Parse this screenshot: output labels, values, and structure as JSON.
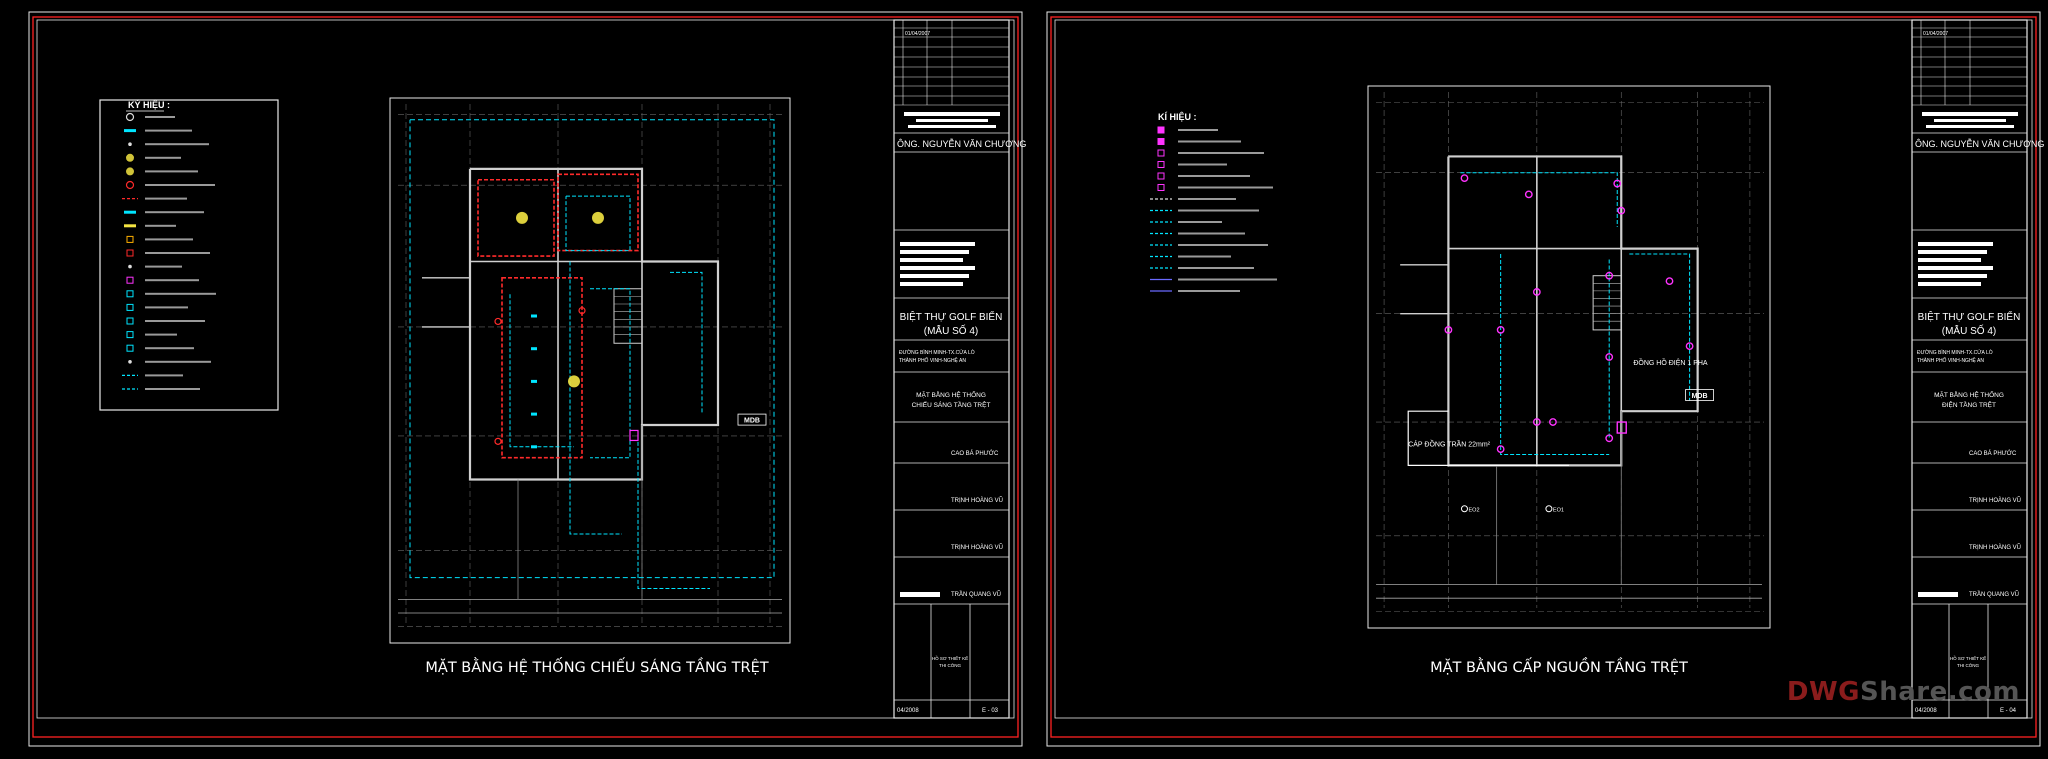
{
  "watermark": {
    "left": "DWG",
    "right": "Share.com"
  },
  "colors": {
    "frame_red": "#ff2222",
    "frame_white": "#e8e8e8",
    "wire_cyan": "#00e5ff",
    "wall_white": "#d0d0d0",
    "grid": "#3a3a3a",
    "magenta": "#ff33ff",
    "red_room": "#ff2a2a",
    "yellow": "#f4e542"
  },
  "sheets": [
    {
      "title": "MẶT BẰNG HỆ THỐNG CHIẾU SÁNG TẦNG TRỆT",
      "legend": {
        "heading": "KÝ HIỆU :",
        "kind": "lighting"
      },
      "mdb_label": "MDB",
      "block": {
        "date": "01/04/2007",
        "owner": "ÔNG. NGUYỄN VĂN CHƯƠNG",
        "project_name": "BIỆT THỰ GOLF BIỂN",
        "project_model": "(MẪU SỐ 4)",
        "location_1": "ĐƯỜNG BÌNH MINH-TX.CỬA LÒ",
        "location_2": "THÀNH PHỐ VINH-NGHỆ AN",
        "drawing_1": "MẶT BẰNG HỆ THỐNG",
        "drawing_2": "CHIẾU SÁNG TẦNG TRỆT",
        "chief": "CAO BÁ PHƯỚC",
        "designer": "TRỊNH HOÀNG VŨ",
        "cad": "TRỊNH HOÀNG VŨ",
        "manager": "TRẦN QUANG VŨ",
        "stage_1": "HỒ SƠ THIẾT KẾ",
        "stage_2": "THI CÔNG",
        "issue_date": "04/2008",
        "sheet_no": "E - 03"
      }
    },
    {
      "title": "MẶT BẰNG CẤP NGUỒN TẦNG TRỆT",
      "legend": {
        "heading": "KÍ HIỆU :",
        "kind": "power"
      },
      "mdb_label": "MDB",
      "notes": {
        "feed": "CÁP ĐỒNG TRẦN 22mm²",
        "meter": "ĐỒNG HỒ ĐIỆN 1 PHA",
        "e1": "EO1",
        "e2": "EO2"
      },
      "block": {
        "date": "01/04/2007",
        "owner": "ÔNG. NGUYỄN VĂN CHƯƠNG",
        "project_name": "BIỆT THỰ GOLF BIỂN",
        "project_model": "(MẪU SỐ 4)",
        "location_1": "ĐƯỜNG BÌNH MINH-TX.CỬA LÒ",
        "location_2": "THÀNH PHỐ VINH-NGHỆ AN",
        "drawing_1": "MẶT BẰNG HỆ THỐNG",
        "drawing_2": "ĐIỆN TẦNG TRỆT",
        "chief": "CAO BÁ PHƯỚC",
        "designer": "TRỊNH HOÀNG VŨ",
        "cad": "TRỊNH HOÀNG VŨ",
        "manager": "TRẦN QUANG VŨ",
        "stage_1": "HỒ SƠ THIẾT KẾ",
        "stage_2": "THI CÔNG",
        "issue_date": "04/2008",
        "sheet_no": "E - 04"
      }
    }
  ]
}
